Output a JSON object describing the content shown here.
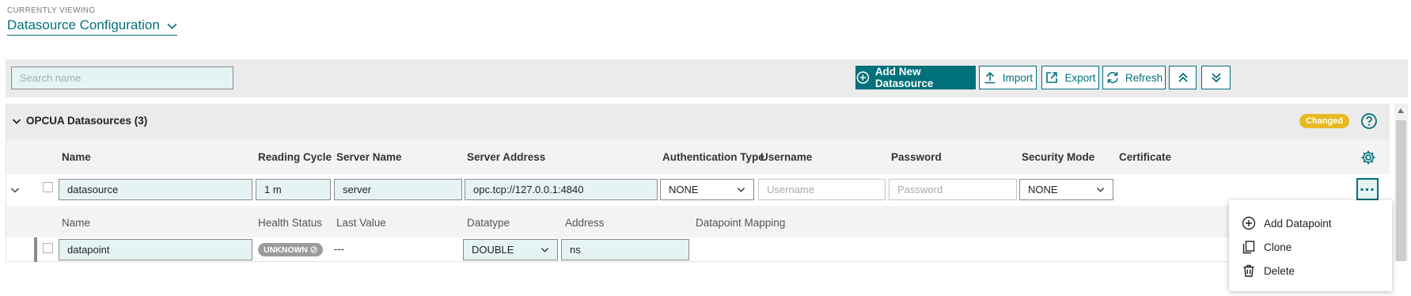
{
  "header": {
    "currently_viewing_label": "CURRENTLY VIEWING",
    "page_title": "Datasource Configuration"
  },
  "toolbar": {
    "search_placeholder": "Search name",
    "add_new_label": "Add New Datasource",
    "import_label": "Import",
    "export_label": "Export",
    "refresh_label": "Refresh"
  },
  "panel": {
    "title": "OPCUA Datasources (3)",
    "changed_badge": "Changed"
  },
  "columns": {
    "name": "Name",
    "reading_cycle": "Reading Cycle",
    "server_name": "Server Name",
    "server_address": "Server Address",
    "auth_type": "Authentication Type",
    "username": "Username",
    "password": "Password",
    "security_mode": "Security Mode",
    "certificate": "Certificate"
  },
  "datasource_row": {
    "name": "datasource",
    "reading_cycle": "1 m",
    "server_name": "server",
    "server_address": "opc.tcp://127.0.0.1:4840",
    "auth_type": "NONE",
    "username_placeholder": "Username",
    "password_placeholder": "Password",
    "security_mode": "NONE"
  },
  "datapoint_columns": {
    "name": "Name",
    "health_status": "Health Status",
    "last_value": "Last Value",
    "datatype": "Datatype",
    "address": "Address",
    "datapoint_mapping": "Datapoint Mapping"
  },
  "datapoint_row": {
    "name": "datapoint",
    "health_status": "UNKNOWN",
    "last_value": "---",
    "datatype": "DOUBLE",
    "address": "ns"
  },
  "context_menu": {
    "add_datapoint": "Add Datapoint",
    "clone": "Clone",
    "delete": "Delete"
  },
  "colors": {
    "accent": "#00707a",
    "changed_badge": "#e8b923",
    "unknown_pill": "#9b9b9b"
  }
}
